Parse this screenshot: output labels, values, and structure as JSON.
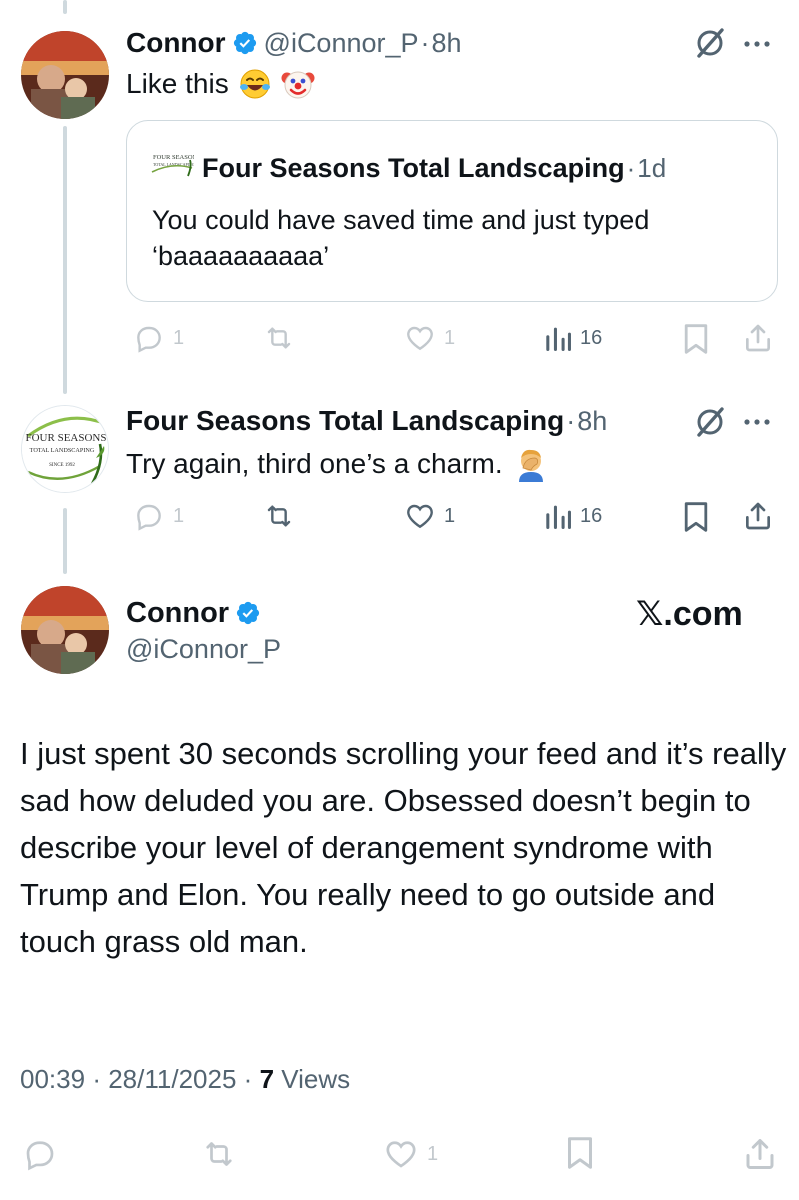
{
  "colors": {
    "verified": "#1d9bf0",
    "muted": "#536471",
    "text": "#0f1419",
    "border": "#cfd9de"
  },
  "reply1": {
    "name": "Connor",
    "handle": "@iConnor_P",
    "dot": "·",
    "time": "8h",
    "text": "Like this",
    "emojis": [
      "face-with-tears-of-joy",
      "clown-face"
    ],
    "quote": {
      "name": "Four Seasons Total Landscaping",
      "dot": "·",
      "time": "1d",
      "text": "You could have saved time and just typed ‘baaaaaaaaaa’"
    },
    "actions": {
      "replies": "1",
      "likes": "1",
      "views": "16"
    }
  },
  "reply2": {
    "name": "Four Seasons Total Landscaping",
    "dot": "·",
    "time": "8h",
    "text": "Try again, third one’s a charm.",
    "emoji": "person-facepalming",
    "logo_text": {
      "line1": "FOUR SEASONS",
      "line2": "TOTAL LANDSCAPING",
      "line3": "SINCE 1992"
    },
    "actions": {
      "replies": "1",
      "likes": "1",
      "views": "16"
    }
  },
  "main": {
    "name": "Connor",
    "handle": "@iConnor_P",
    "watermark": "𝕏.com",
    "text": "I just spent 30 seconds scrolling your feed and it’s really sad how deluded you are. Obsessed doesn’t begin to describe your level of derangement syndrome with Trump and Elon. You really need to go outside and touch grass old man.",
    "time": "00:39",
    "dot": "·",
    "date": "28/11/2025",
    "views_count": "7",
    "views_label": "Views",
    "actions": {
      "likes": "1"
    }
  }
}
